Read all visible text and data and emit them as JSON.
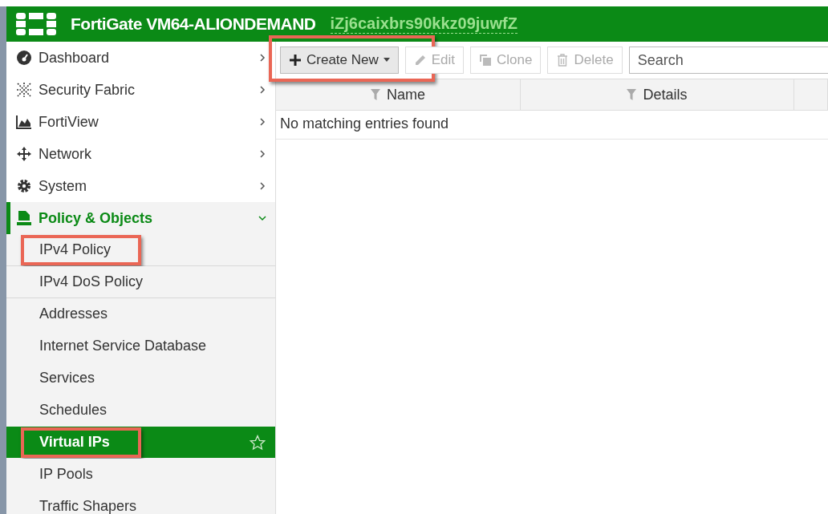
{
  "header": {
    "product": "FortiGate VM64-ALIONDEMAND",
    "hostname": "iZj6caixbrs90kkz09juwfZ"
  },
  "sidebar": {
    "items": [
      {
        "label": "Dashboard",
        "expanded": false,
        "annotated": false
      },
      {
        "label": "Security Fabric",
        "expanded": false,
        "annotated": false
      },
      {
        "label": "FortiView",
        "expanded": false,
        "annotated": false
      },
      {
        "label": "Network",
        "expanded": false,
        "annotated": false
      },
      {
        "label": "System",
        "expanded": false,
        "annotated": false
      },
      {
        "label": "Policy & Objects",
        "expanded": true,
        "annotated": false,
        "children": [
          {
            "label": "IPv4 Policy",
            "selected": false,
            "annotated": true
          },
          {
            "label": "IPv4 DoS Policy",
            "selected": false,
            "annotated": false
          },
          {
            "label": "Addresses",
            "selected": false,
            "annotated": false
          },
          {
            "label": "Internet Service Database",
            "selected": false,
            "annotated": false
          },
          {
            "label": "Services",
            "selected": false,
            "annotated": false
          },
          {
            "label": "Schedules",
            "selected": false,
            "annotated": false
          },
          {
            "label": "Virtual IPs",
            "selected": true,
            "annotated": true
          },
          {
            "label": "IP Pools",
            "selected": false,
            "annotated": false
          },
          {
            "label": "Traffic Shapers",
            "selected": false,
            "annotated": false
          }
        ]
      }
    ]
  },
  "toolbar": {
    "buttons": [
      {
        "label": "Create New",
        "disabled": false,
        "dropdown": true,
        "annotated": true
      },
      {
        "label": "Edit",
        "disabled": true,
        "dropdown": false,
        "annotated": false
      },
      {
        "label": "Clone",
        "disabled": true,
        "dropdown": false,
        "annotated": false
      },
      {
        "label": "Delete",
        "disabled": true,
        "dropdown": false,
        "annotated": false
      }
    ],
    "search": {
      "placeholder": "Search"
    }
  },
  "table": {
    "columns": [
      "Name",
      "Details"
    ],
    "empty_message": "No matching entries found"
  }
}
